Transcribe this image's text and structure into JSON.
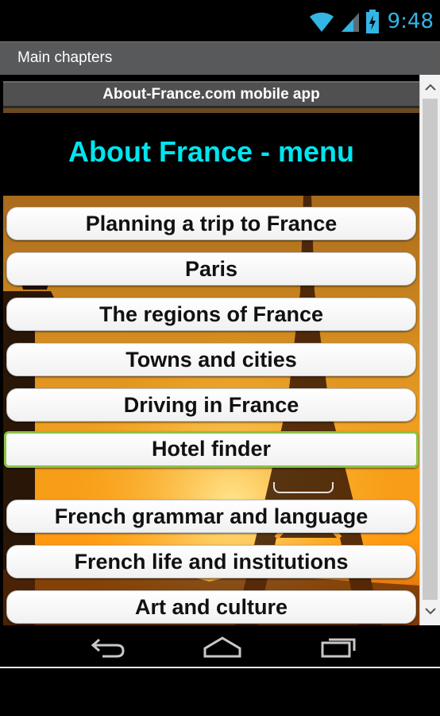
{
  "status_bar": {
    "time": "9:48",
    "icons": [
      "wifi-icon",
      "signal-icon",
      "battery-charging-icon"
    ],
    "accent_color": "#33b5e5"
  },
  "action_bar": {
    "title": "Main chapters"
  },
  "app": {
    "header_label": "About-France.com mobile app",
    "menu_title": "About France - menu",
    "menu_title_color": "#00e5ef",
    "selected_item_border_color": "#8bc34a"
  },
  "menu": {
    "items": [
      {
        "label": "Planning a trip to France"
      },
      {
        "label": "Paris"
      },
      {
        "label": "The regions of France"
      },
      {
        "label": "Towns and cities"
      },
      {
        "label": "Driving in France"
      },
      {
        "label": "Hotel finder",
        "selected": true
      },
      {
        "label": "French grammar and language"
      },
      {
        "label": "French life and institutions"
      },
      {
        "label": "Art and culture"
      }
    ]
  },
  "scrollbar": {
    "icons": [
      "chevron-up-icon",
      "chevron-down-icon"
    ]
  },
  "nav_bar": {
    "icons": [
      "back-icon",
      "home-icon",
      "recent-apps-icon"
    ]
  }
}
